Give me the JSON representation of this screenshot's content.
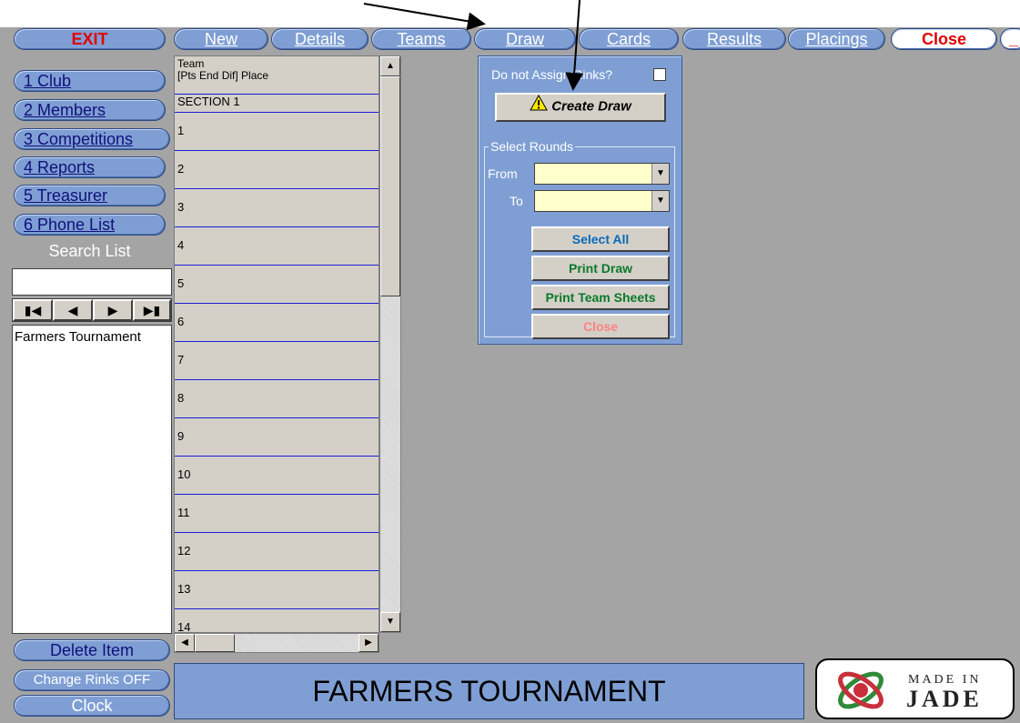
{
  "topbar": {
    "exit": "EXIT",
    "tabs": [
      "New",
      "Details",
      "Teams",
      "Draw",
      "Cards",
      "Results",
      "Placings"
    ],
    "close": "Close",
    "minimize": "_"
  },
  "sidebar": {
    "items": [
      "1 Club",
      "2 Members",
      "3 Competitions",
      "4 Reports",
      "5 Treasurer",
      "6 Phone List"
    ],
    "search_label": "Search List",
    "search_value": "",
    "list_items": [
      "Farmers Tournament"
    ],
    "delete_item": "Delete Item",
    "change_rinks": "Change Rinks OFF",
    "clock": "Clock"
  },
  "grid": {
    "header_line1": "Team",
    "header_line2": "[Pts End Dif]  Place",
    "section": "SECTION 1",
    "rows": [
      "1",
      "2",
      "3",
      "4",
      "5",
      "6",
      "7",
      "8",
      "9",
      "10",
      "11",
      "12",
      "13",
      "14"
    ]
  },
  "draw_dialog": {
    "checkbox_label": "Do not Assign Rinks?",
    "checkbox_checked": false,
    "create_draw": "Create Draw",
    "group_label": "Select Rounds",
    "from_label": "From",
    "from_value": "",
    "to_label": "To",
    "to_value": "",
    "select_all": "Select All",
    "print_draw": "Print Draw",
    "print_team_sheets": "Print Team Sheets",
    "close": "Close"
  },
  "status": {
    "title": "FARMERS TOURNAMENT"
  },
  "logo": {
    "line1": "MADE IN",
    "line2": "JADE"
  },
  "colors": {
    "accent_blue": "#7f9fd4",
    "panel_gray": "#a4a4a4",
    "exit_red": "#e00000",
    "print_green": "#0a7a2a",
    "select_blue": "#0a6ab8",
    "close_pink": "#ff8080"
  }
}
